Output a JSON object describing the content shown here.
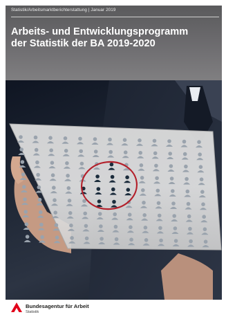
{
  "cover": {
    "series_line": "Statistik/Arbeitsmarktberichterstattung | Januar 2019",
    "title_lines": [
      "Arbeits- und Entwicklungsprogramm",
      "der Statistik der BA 2019-2020"
    ]
  },
  "photo": {
    "description_icon": "people-grid-tablet-icon"
  },
  "footer": {
    "organization": "Bundesagentur für Arbeit",
    "department": "Statistik",
    "logo_icon": "ba-logo-icon",
    "brand_color": "#e2001a"
  }
}
